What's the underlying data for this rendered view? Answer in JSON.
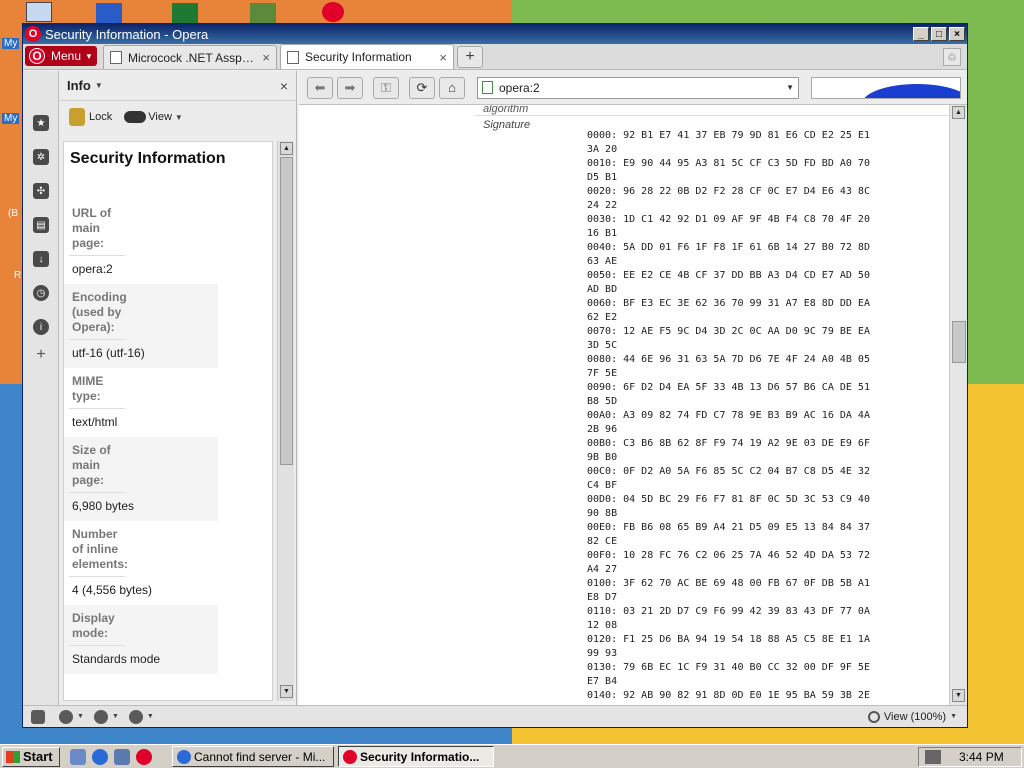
{
  "desktop": {
    "labels": [
      "My",
      "My",
      "(B",
      "R"
    ]
  },
  "window": {
    "title": "Security Information - Opera",
    "controls": {
      "minimize": "_",
      "maximize": "□",
      "close": "×"
    }
  },
  "tabbar": {
    "menu_label": "Menu",
    "tabs": [
      {
        "label": "Microcock .NET Assport: ...",
        "active": false
      },
      {
        "label": "Security Information",
        "active": true
      }
    ],
    "close_glyph": "×",
    "new_tab_glyph": "+"
  },
  "sidebar_icons": [
    "bookmarks-icon",
    "settings-icon",
    "widgets-icon",
    "notes-icon",
    "downloads-icon",
    "history-icon",
    "info-icon",
    "add-panel-icon"
  ],
  "panel": {
    "title": "Info",
    "close_glyph": "×",
    "lock_label": "Lock",
    "view_label": "View",
    "heading": "Security Information",
    "fields": [
      {
        "label": "URL of main page:",
        "value": "opera:2"
      },
      {
        "label": "Encoding (used by Opera):",
        "value": "utf-16 (utf-16)"
      },
      {
        "label": "MIME type:",
        "value": "text/html"
      },
      {
        "label": "Size of main page:",
        "value": "6,980 bytes"
      },
      {
        "label": "Number of inline elements:",
        "value": "4 (4,556 bytes)"
      },
      {
        "label": "Display mode:",
        "value": "Standards mode"
      }
    ]
  },
  "toolbar": {
    "address": "opera:2"
  },
  "content": {
    "cut_label": "algorithm",
    "signature_label": "Signature",
    "hex_lines": [
      "0000: 92 B1 E7 41 37 EB 79 9D 81 E6 CD E2 25 E1",
      "3A 20",
      "0010: E9 90 44 95 A3 81 5C CF C3 5D FD BD A0 70",
      "D5 B1",
      "0020: 96 28 22 0B D2 F2 28 CF 0C E7 D4 E6 43 8C",
      "24 22",
      "0030: 1D C1 42 92 D1 09 AF 9F 4B F4 C8 70 4F 20",
      "16 B1",
      "0040: 5A DD 01 F6 1F F8 1F 61 6B 14 27 B0 72 8D",
      "63 AE",
      "0050: EE E2 CE 4B CF 37 DD BB A3 D4 CD E7 AD 50",
      "AD BD",
      "0060: BF E3 EC 3E 62 36 70 99 31 A7 E8 8D DD EA",
      "62 E2",
      "0070: 12 AE F5 9C D4 3D 2C 0C AA D0 9C 79 BE EA",
      "3D 5C",
      "0080: 44 6E 96 31 63 5A 7D D6 7E 4F 24 A0 4B 05",
      "7F 5E",
      "0090: 6F D2 D4 EA 5F 33 4B 13 D6 57 B6 CA DE 51",
      "B8 5D",
      "00A0: A3 09 82 74 FD C7 78 9E B3 B9 AC 16 DA 4A",
      "2B 96",
      "00B0: C3 B6 8B 62 8F F9 74 19 A2 9E 03 DE E9 6F",
      "9B B0",
      "00C0: 0F D2 A0 5A F6 85 5C C2 04 B7 C8 D5 4E 32",
      "C4 BF",
      "00D0: 04 5D BC 29 F6 F7 81 8F 0C 5D 3C 53 C9 40",
      "90 8B",
      "00E0: FB B6 08 65 B9 A4 21 D5 09 E5 13 84 84 37",
      "82 CE",
      "00F0: 10 28 FC 76 C2 06 25 7A 46 52 4D DA 53 72",
      "A4 27",
      "0100: 3F 62 70 AC BE 69 48 00 FB 67 0F DB 5B A1",
      "E8 D7",
      "0110: 03 21 2D D7 C9 F6 99 42 39 83 43 DF 77 0A",
      "12 08",
      "0120: F1 25 D6 BA 94 19 54 18 88 A5 C5 8E E1 1A",
      "99 93",
      "0130: 79 6B EC 1C F9 31 40 B0 CC 32 00 DF 9F 5E",
      "E7 B4",
      "0140: 92 AB 90 82 91 8D 0D E0 1E 95 BA 59 3B 2E"
    ]
  },
  "status": {
    "zoom": "View (100%)"
  },
  "taskbar": {
    "start": "Start",
    "items": [
      {
        "label": "Cannot find server - Mi...",
        "active": false
      },
      {
        "label": "Security Informatio...",
        "active": true
      }
    ],
    "clock": "3:44 PM"
  }
}
